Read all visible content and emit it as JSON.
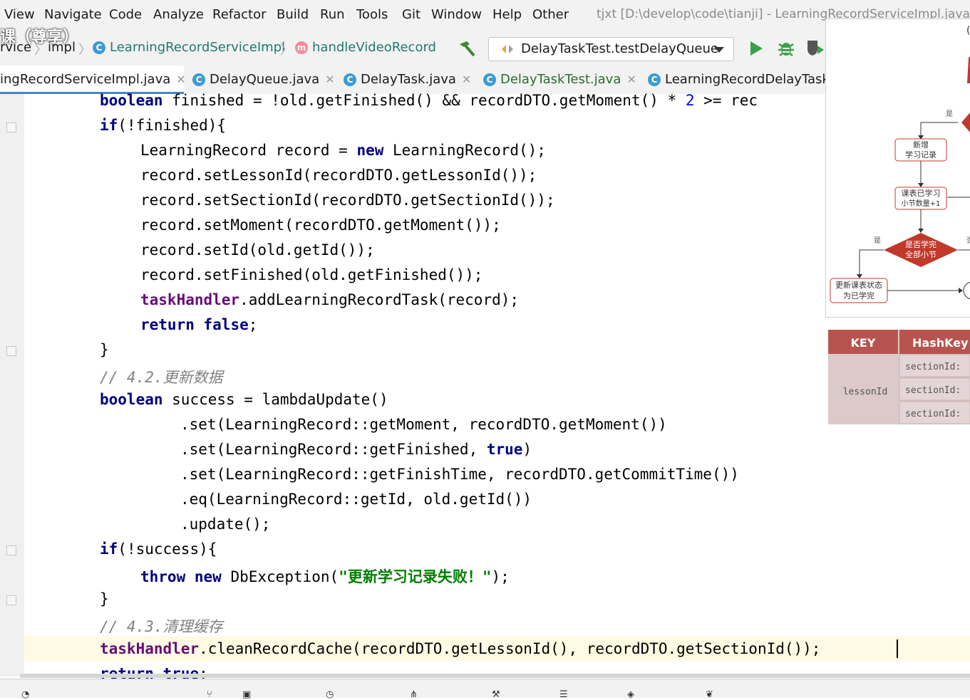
{
  "menu": {
    "items": [
      "View",
      "Navigate",
      "Code",
      "Analyze",
      "Refactor",
      "Build",
      "Run",
      "Tools",
      "Git",
      "Window",
      "Help",
      "Other"
    ],
    "window_title": "tjxt [D:\\develop\\code\\tianji] - LearningRecordServiceImpl.java"
  },
  "watermark": "课（尊享）",
  "breadcrumb": {
    "items": [
      "rvice",
      "impl",
      "LearningRecordServiceImpl",
      "handleVideoRecord"
    ]
  },
  "run_config": {
    "label": "DelayTaskTest.testDelayQueue"
  },
  "tabs": [
    {
      "label": "ingRecordServiceImpl.java"
    },
    {
      "label": "DelayQueue.java"
    },
    {
      "label": "DelayTask.java"
    },
    {
      "label": "DelayTaskTest.java"
    },
    {
      "label": "LearningRecordDelayTaskH"
    }
  ],
  "code": {
    "l1": {
      "a": "boolean",
      "b": " finished = !old.getFinished() && recordDTO.getMoment() * ",
      "c": "2",
      "d": " >= rec"
    },
    "l2": {
      "a": "if",
      "b": "(!finished){"
    },
    "l3": {
      "a": "LearningRecord record = ",
      "b": "new",
      "c": " LearningRecord();"
    },
    "l4": "record.setLessonId(recordDTO.getLessonId());",
    "l5": "record.setSectionId(recordDTO.getSectionId());",
    "l6": "record.setMoment(recordDTO.getMoment());",
    "l7": "record.setId(old.getId());",
    "l8": "record.setFinished(old.getFinished());",
    "l9": {
      "a": "taskHandler",
      "b": ".addLearningRecordTask(record);"
    },
    "l10": {
      "a": "return",
      "b": " ",
      "c": "false",
      "d": ";"
    },
    "l11": "}",
    "l12": "// 4.2.更新数据",
    "l13": {
      "a": "boolean",
      "b": " success = lambdaUpdate()"
    },
    "l14": ".set(LearningRecord::getMoment, recordDTO.getMoment())",
    "l15": {
      "a": ".set(LearningRecord::getFinished, ",
      "b": "true",
      "c": ")"
    },
    "l16": ".set(LearningRecord::getFinishTime, recordDTO.getCommitTime())",
    "l17": ".eq(LearningRecord::getId, old.getId())",
    "l18": ".update();",
    "l19": {
      "a": "if",
      "b": "(!success){"
    },
    "l20": {
      "a": "throw",
      "b": " ",
      "c": "new",
      "d": " DbException(",
      "e": "\"更新学习记录失败！\"",
      "f": ");"
    },
    "l21": "}",
    "l22": "// 4.3.清理缓存",
    "l23": {
      "a": "taskHandler",
      "b": ".cleanRecordCache(recordDTO.getLessonId(), recordDTO.getSectionId());"
    },
    "l24": {
      "a": "return",
      "b": " ",
      "c": "true",
      "d": ";"
    }
  },
  "flowchart": {
    "yes1": "是",
    "box1_l1": "新增",
    "box1_l2": "学习记录",
    "box2_l1": "课表已学习",
    "box2_l2": "小节数量+1",
    "yes2": "是",
    "no2": "否",
    "diamond_l1": "是否学完",
    "diamond_l2": "全部小节",
    "box3_l1": "更新课表状态",
    "box3_l2": "为已学完",
    "top_char": "("
  },
  "redis_table": {
    "headers": [
      "KEY",
      "HashKey"
    ],
    "key": "lessonId",
    "rows": [
      "sectionId:",
      "sectionId:",
      "sectionId:"
    ]
  },
  "colors": {
    "keyword": "#000080",
    "field": "#660e7a",
    "number": "#0000ff",
    "string": "#008000",
    "comment": "#808080",
    "table_header": "#b85450",
    "flow_red": "#c0392b"
  }
}
